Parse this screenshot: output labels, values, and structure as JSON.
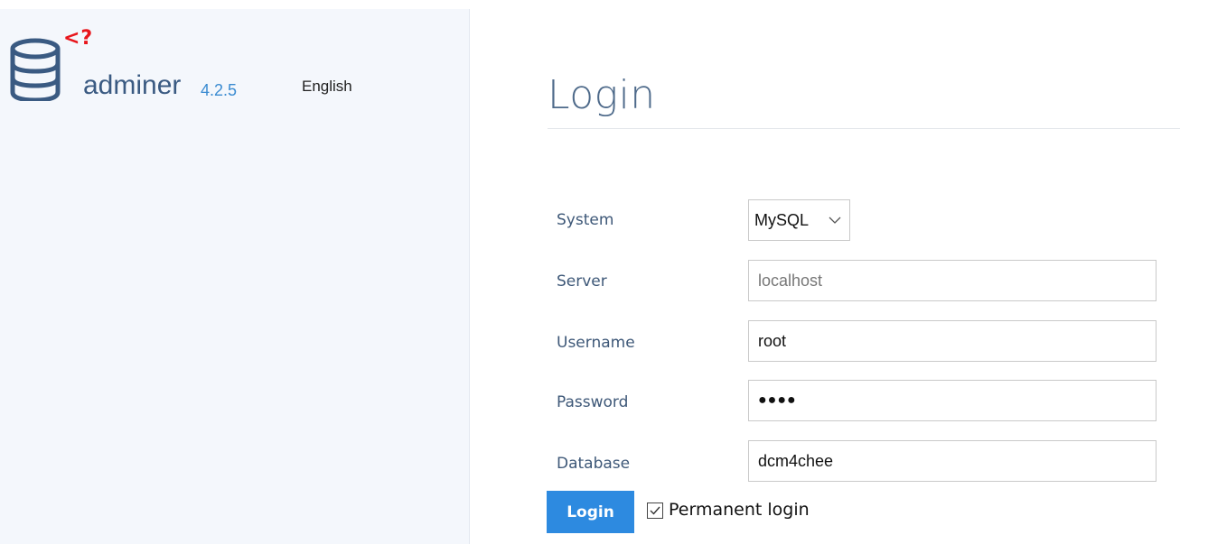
{
  "sidebar": {
    "logo_mark": "<?",
    "app_name": "adminer",
    "version": "4.2.5",
    "language": "English"
  },
  "main": {
    "title": "Login",
    "form": {
      "system": {
        "label": "System",
        "value": "MySQL"
      },
      "server": {
        "label": "Server",
        "value": "",
        "placeholder": "localhost"
      },
      "username": {
        "label": "Username",
        "value": "root"
      },
      "password": {
        "label": "Password",
        "value": "●●●●"
      },
      "database": {
        "label": "Database",
        "value": "dcm4chee"
      }
    },
    "login_button": "Login",
    "permanent_login": {
      "label": "Permanent login",
      "checked": true
    }
  },
  "colors": {
    "accent": "#2d8ae0",
    "sidebar_bg": "#f4f7fc",
    "logo_red": "#e8151b",
    "label": "#3e5878"
  }
}
